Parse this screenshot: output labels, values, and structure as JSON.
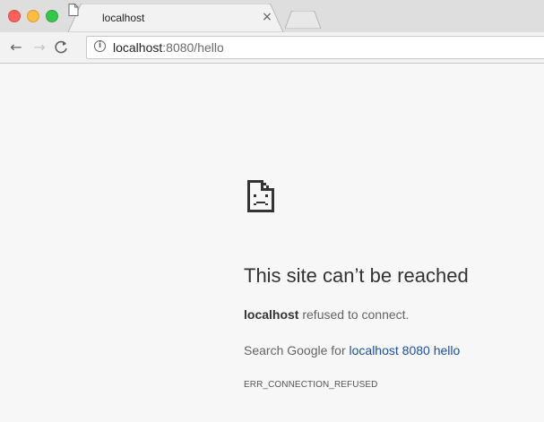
{
  "tab": {
    "title": "localhost",
    "close_glyph": "×"
  },
  "omnibox": {
    "info_glyph": "i",
    "host": "localhost",
    "rest": ":8080/hello"
  },
  "nav": {
    "back_glyph": "←",
    "forward_glyph": "→",
    "reload_glyph": "C"
  },
  "error": {
    "heading": "This site can’t be reached",
    "host": "localhost",
    "refused_text": " refused to connect.",
    "search_prefix": "Search Google for ",
    "search_link": "localhost 8080 hello",
    "code": "ERR_CONNECTION_REFUSED"
  },
  "icons": {
    "traffic_close": "red-dot-icon",
    "traffic_minimize": "yellow-dot-icon",
    "traffic_zoom": "green-dot-icon",
    "tab_page": "page-icon",
    "sad_page": "sad-page-icon"
  },
  "colors": {
    "link": "#1a4fa3",
    "heading": "#333333",
    "traffic_red": "#fc605b",
    "traffic_yellow": "#fdbc40",
    "traffic_green": "#34c84a"
  }
}
